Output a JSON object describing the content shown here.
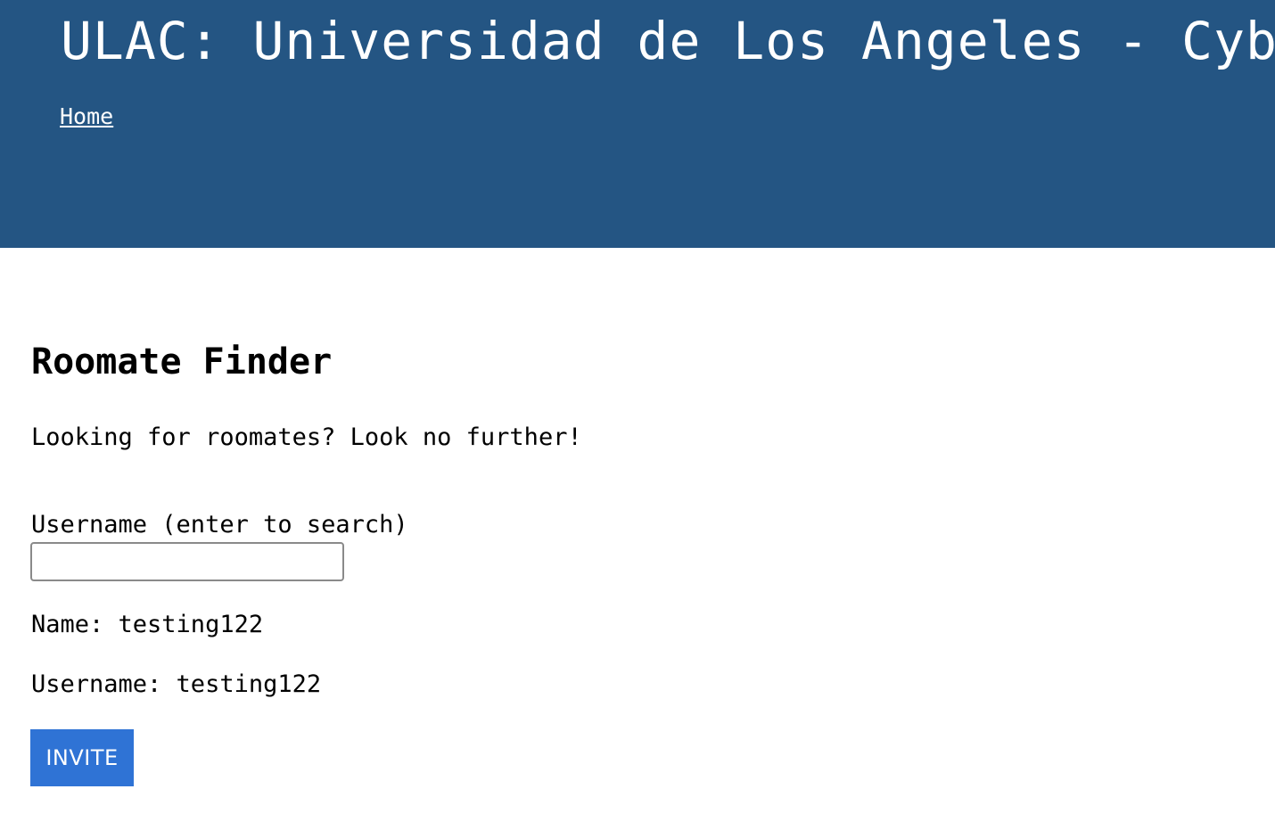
{
  "header": {
    "title": "ULAC: Universidad de Los Angeles - Cyber",
    "nav": {
      "home_label": "Home"
    }
  },
  "main": {
    "heading": "Roomate Finder",
    "intro": "Looking for roomates? Look no further!",
    "search": {
      "label": "Username (enter to search)",
      "value": ""
    },
    "result": {
      "name_line": "Name: testing122",
      "username_line": "Username: testing122"
    },
    "invite_label": "INVITE"
  },
  "colors": {
    "header_bg": "#245583",
    "button_bg": "#2f73d5"
  }
}
